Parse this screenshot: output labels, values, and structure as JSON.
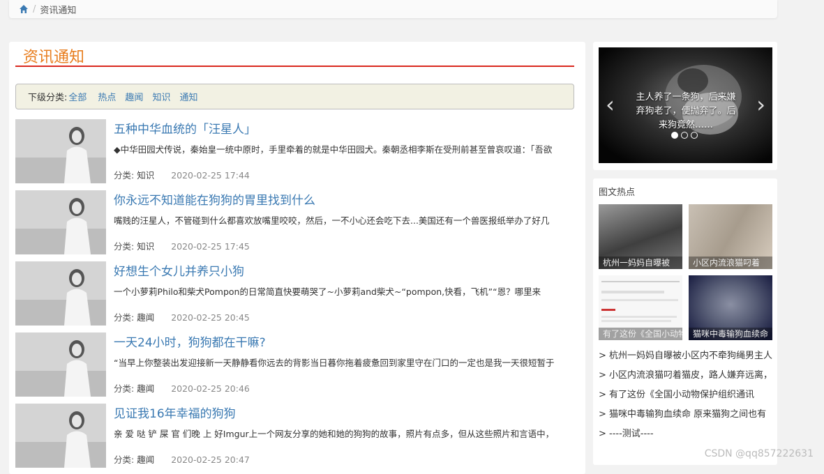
{
  "breadcrumb": {
    "separator": "/",
    "current": "资讯通知"
  },
  "main": {
    "title": "资讯通知",
    "subcategories": {
      "label": "下级分类:",
      "items": [
        "全部",
        "热点",
        "趣闻",
        "知识",
        "通知"
      ]
    },
    "meta_label": "分类:",
    "articles": [
      {
        "title": "五种中华血统的「汪星人」",
        "excerpt": "◆中华田园犬传说，秦始皇一统中原时，手里牵着的就是中华田园犬。秦朝丞相李斯在受刑前甚至曾哀叹道：「吾欲",
        "category": "知识",
        "date": "2020-02-25 17:44"
      },
      {
        "title": "你永远不知道能在狗狗的胃里找到什么",
        "excerpt": "嘴贱的汪星人，不管碰到什么都喜欢放嘴里咬咬，然后，一不小心还会吃下去...美国还有一个兽医报纸举办了好几",
        "category": "知识",
        "date": "2020-02-25 17:45"
      },
      {
        "title": "好想生个女儿并养只小狗",
        "excerpt": "一个小萝莉Philo和柴犬Pompon的日常简直快要萌哭了~小萝莉and柴犬~“pompon,快看，飞机”“恩？哪里来",
        "category": "趣闻",
        "date": "2020-02-25 20:45"
      },
      {
        "title": "一天24小时，狗狗都在干嘛?",
        "excerpt": "“当早上你整装出发迎接新一天静静看你远去的背影当日暮你拖着疲惫回到家里守在门口的一定也是我一天很短暂于",
        "category": "趣闻",
        "date": "2020-02-25 20:46"
      },
      {
        "title": "见证我16年幸福的狗狗",
        "excerpt": "亲 爱 哒 铲 屎 官 们晚 上 好Imgur上一个网友分享的她和她的狗狗的故事，照片有点多，但从这些照片和言语中，",
        "category": "趣闻",
        "date": "2020-02-25 20:47"
      }
    ]
  },
  "carousel": {
    "caption": "主人养了一条狗，后来嫌弃狗老了，便抛弃了。后来狗竟然……",
    "prev": "‹",
    "next": "›"
  },
  "hot": {
    "title": "图文热点",
    "tiles": [
      "杭州一妈妈自曝被",
      "小区内流浪猫叼着",
      "有了这份《全国小动物",
      "猫咪中毒输狗血续命"
    ],
    "list": [
      "> 杭州一妈妈自曝被小区内不牵狗绳男主人",
      "> 小区内流浪猫叼着猫皮，路人嫌弃远离，",
      "> 有了这份《全国小动物保护组织通讯",
      "> 猫咪中毒输狗血续命 原来猫狗之间也有",
      "> ----测试----"
    ]
  },
  "watermark": "CSDN @qq857222631",
  "colors": {
    "accent_title": "#e87d1e",
    "rule": "#d9281e",
    "link": "#3a79b2",
    "subcat_bg": "#f2f1e3"
  }
}
